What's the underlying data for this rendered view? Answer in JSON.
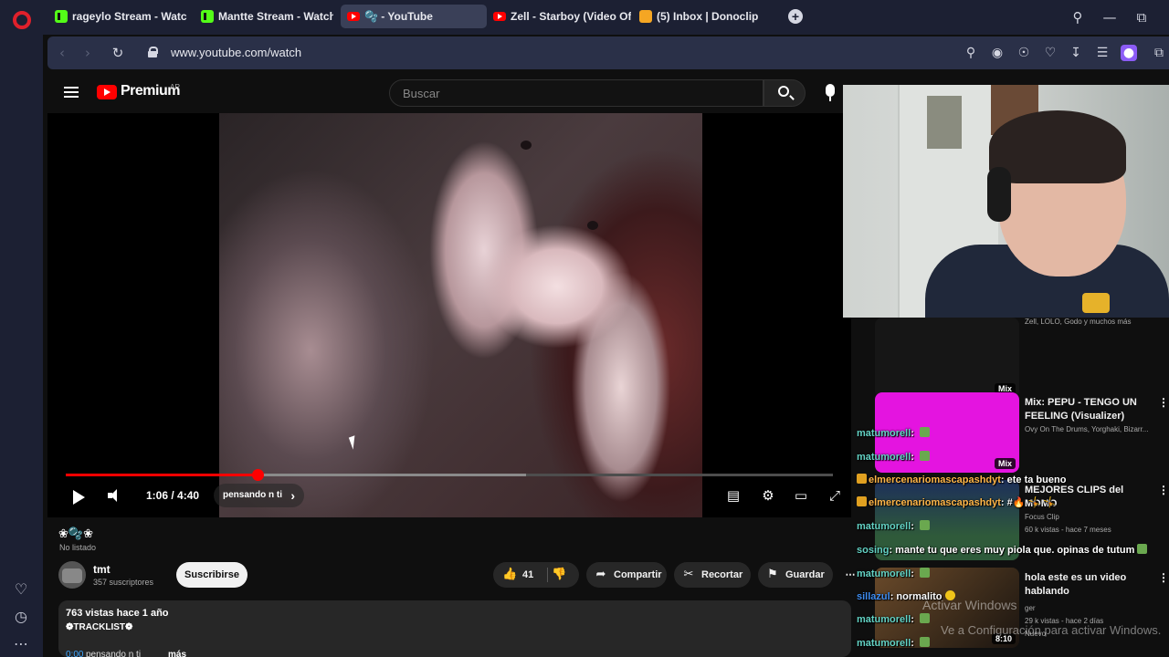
{
  "browser": {
    "tabs": [
      {
        "title": "rageylo Stream - Watch Li",
        "icon": "kick-icon"
      },
      {
        "title": "Mantte Stream - Watch Li",
        "icon": "kick-icon"
      },
      {
        "title": "🫧 - YouTube",
        "icon": "youtube-icon",
        "active": true
      },
      {
        "title": "Zell - Starboy (Video Ofici",
        "icon": "youtube-icon"
      },
      {
        "title": "(5) Inbox | Donoclip",
        "icon": "donoclip-icon"
      }
    ],
    "url": "www.youtube.com/watch"
  },
  "youtube": {
    "brand": "Premium",
    "region": "AR",
    "search_placeholder": "Buscar",
    "player": {
      "progress_fraction": 0.25,
      "buffered_fraction": 0.6,
      "time": "1:06 / 4:40",
      "chapter": "pensando n ti"
    },
    "video": {
      "title": "❀🫧❀",
      "unlisted": "No listado",
      "channel": "tmt",
      "subscribers": "357 suscriptores",
      "subscribe_label": "Suscribirse",
      "likes": "41",
      "share_label": "Compartir",
      "clip_label": "Recortar",
      "save_label": "Guardar"
    },
    "description": {
      "stats": "763 vistas  hace 1 año",
      "line1": "❁TRACKLIST❁",
      "timestamp": "0:00",
      "track": "pensando n ti",
      "more": "más"
    },
    "recommended": [
      {
        "title": "",
        "meta": "Zell, LOLO, Godo y muchos más",
        "badge": "Mix",
        "color": "#161616"
      },
      {
        "title": "Mix: PEPU - TENGO UN FEELING (Visualizer)",
        "meta": "Ovy On The Drums, Yorghaki, Bizarr...",
        "badge": "Mix",
        "color": "#e414e0"
      },
      {
        "title": "MEJORES CLIPS del MOMO",
        "meta1": "Focus Clip",
        "meta2": "60 k vistas - hace 7 meses",
        "badge": "",
        "color": "#2e5a3a"
      },
      {
        "title": "hola este es un video hablando",
        "meta1": "ger",
        "meta2": "29 k vistas - hace 2 días",
        "meta3": "Nuevo",
        "badge": "8:10",
        "color": "#3a2a1a"
      }
    ]
  },
  "chat": [
    {
      "user": "matumorell",
      "text": "",
      "emote": true,
      "color": "teal"
    },
    {
      "user": "matumorell",
      "text": "",
      "emote": true,
      "color": "teal"
    },
    {
      "user": "elmercenariomascapashdyt",
      "text": "ete ta bueno",
      "badge": true,
      "color": "gold"
    },
    {
      "user": "elmercenariomascapashdyt",
      "text": "#🔥 🤸 🤸",
      "badge": true,
      "color": "gold"
    },
    {
      "user": "matumorell",
      "text": "",
      "emote": true,
      "color": "teal"
    },
    {
      "user": "sosing",
      "text": "mante tu que eres muy piola que. opinas de tutum",
      "emote": true,
      "color": "teal"
    },
    {
      "user": "matumorell",
      "text": "",
      "emote": true,
      "color": "teal"
    },
    {
      "user": "sillazul",
      "text": "normalito",
      "smile": true,
      "color": "blue"
    },
    {
      "user": "matumorell",
      "text": "",
      "emote": true,
      "color": "teal"
    },
    {
      "user": "matumorell",
      "text": "",
      "emote": true,
      "color": "teal"
    }
  ],
  "watermark": {
    "line1": "Activar Windows",
    "line2": "Ve a Configuración para activar Windows."
  }
}
